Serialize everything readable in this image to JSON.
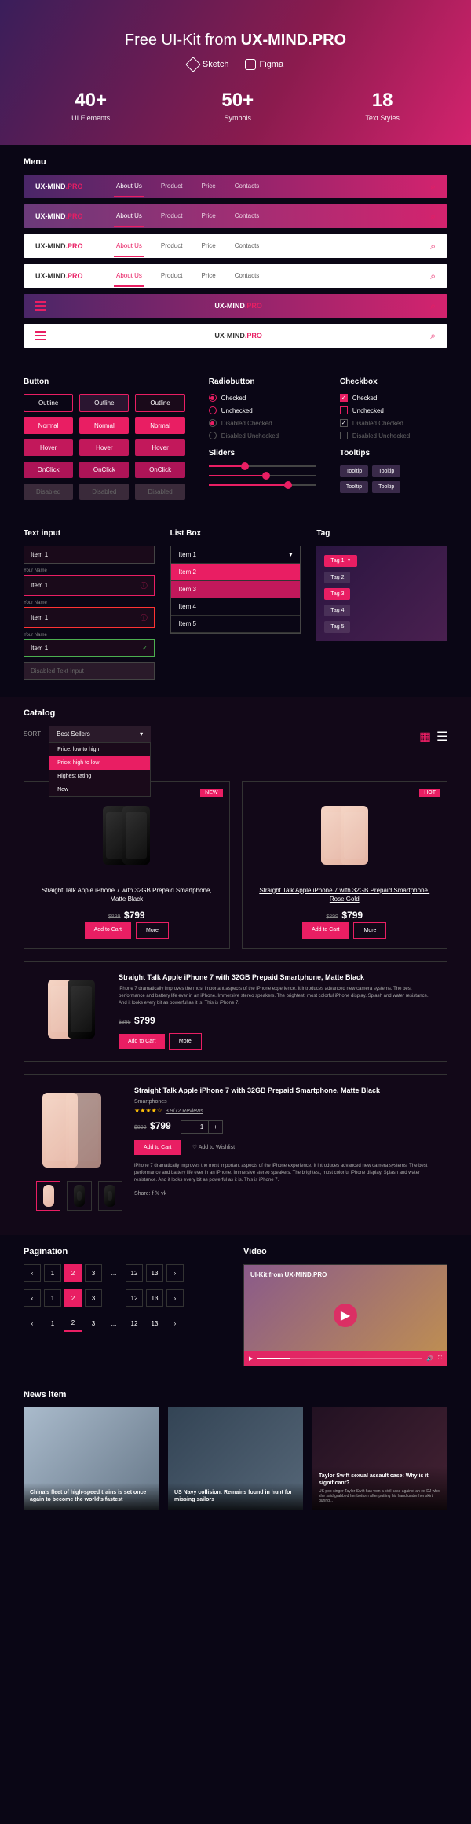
{
  "hero": {
    "title_pre": "Free UI-Kit",
    "title_from": "from",
    "title_brand": "UX-MIND.PRO",
    "tool1": "Sketch",
    "tool2": "Figma",
    "stats": [
      {
        "num": "40+",
        "lbl": "UI Elements"
      },
      {
        "num": "50+",
        "lbl": "Symbols"
      },
      {
        "num": "18",
        "lbl": "Text Styles"
      }
    ]
  },
  "menu": {
    "title": "Menu",
    "logo_main": "UX-MIND",
    "logo_suffix": ".PRO",
    "items": [
      "About Us",
      "Product",
      "Price",
      "Contacts"
    ]
  },
  "buttons": {
    "title": "Button",
    "outline": "Outline",
    "normal": "Normal",
    "hover": "Hover",
    "onclick": "OnClick",
    "disabled": "Disabled"
  },
  "radio": {
    "title": "Radiobutton",
    "checked": "Checked",
    "unchecked": "Unchecked",
    "dis_checked": "Disabled Checked",
    "dis_unchecked": "Disabled Unchecked"
  },
  "checkbox": {
    "title": "Checkbox",
    "checked": "Checked",
    "unchecked": "Unchecked",
    "dis_checked": "Disabled Checked",
    "dis_unchecked": "Disabled Unchecked"
  },
  "sliders": {
    "title": "Sliders"
  },
  "tooltips": {
    "title": "Tooltips",
    "text": "Tooltip"
  },
  "inputs": {
    "title": "Text input",
    "placeholder": "Item 1",
    "label": "Your Name",
    "disabled": "Disabled Text Input"
  },
  "listbox": {
    "title": "List Box",
    "items": [
      "Item 1",
      "Item 2",
      "Item 3",
      "Item 4",
      "Item 5"
    ]
  },
  "tags": {
    "title": "Tag",
    "items": [
      "Tag 1",
      "Tag 2",
      "Tag 3",
      "Tag 4",
      "Tag 5"
    ]
  },
  "catalog": {
    "title": "Catalog",
    "sort": "SORT",
    "sort_sel": "Best Sellers",
    "sort_opts": [
      "Price: low to high",
      "Price: high to low",
      "Highest rating",
      "New"
    ]
  },
  "products": {
    "badge_new": "NEW",
    "badge_hot": "HOT",
    "p1": {
      "title": "Straight Talk Apple iPhone 7 with 32GB Prepaid Smartphone, Matte Black"
    },
    "p2": {
      "title": "Straight Talk Apple iPhone 7 with 32GB Prepaid Smartphone, Rose Gold"
    },
    "price_old": "$899",
    "price": "$799",
    "cart": "Add to Cart",
    "more": "More",
    "desc": "iPhone 7 dramatically improves the most important aspects of the iPhone experience. It introduces advanced new camera systems. The best performance and battery life ever in an iPhone. Immersive stereo speakers. The brightest, most colorful iPhone display. Splash and water resistance. And it looks every bit as powerful as it is. This is iPhone 7.",
    "category": "Smartphones",
    "rating": "3.9/72 Reviews",
    "wishlist": "Add to Wishlist",
    "share": "Share:",
    "qty": "1"
  },
  "pagination": {
    "title": "Pagination",
    "pages": [
      "‹",
      "1",
      "2",
      "3",
      "...",
      "12",
      "13",
      "›"
    ]
  },
  "video": {
    "title": "Video",
    "caption": "UI-Kit from UX-MIND.PRO"
  },
  "news": {
    "title": "News item",
    "items": [
      {
        "title": "China's fleet of high-speed trains is set once again to become the world's fastest",
        "sub": ""
      },
      {
        "title": "US Navy collision: Remains found in hunt for missing sailors",
        "sub": ""
      },
      {
        "title": "Taylor Swift sexual assault case: Why is it significant?",
        "sub": "US pop singer Taylor Swift has won a civil case against an ex-DJ who she said grabbed her bottom after putting his hand under her skirt during..."
      }
    ]
  }
}
